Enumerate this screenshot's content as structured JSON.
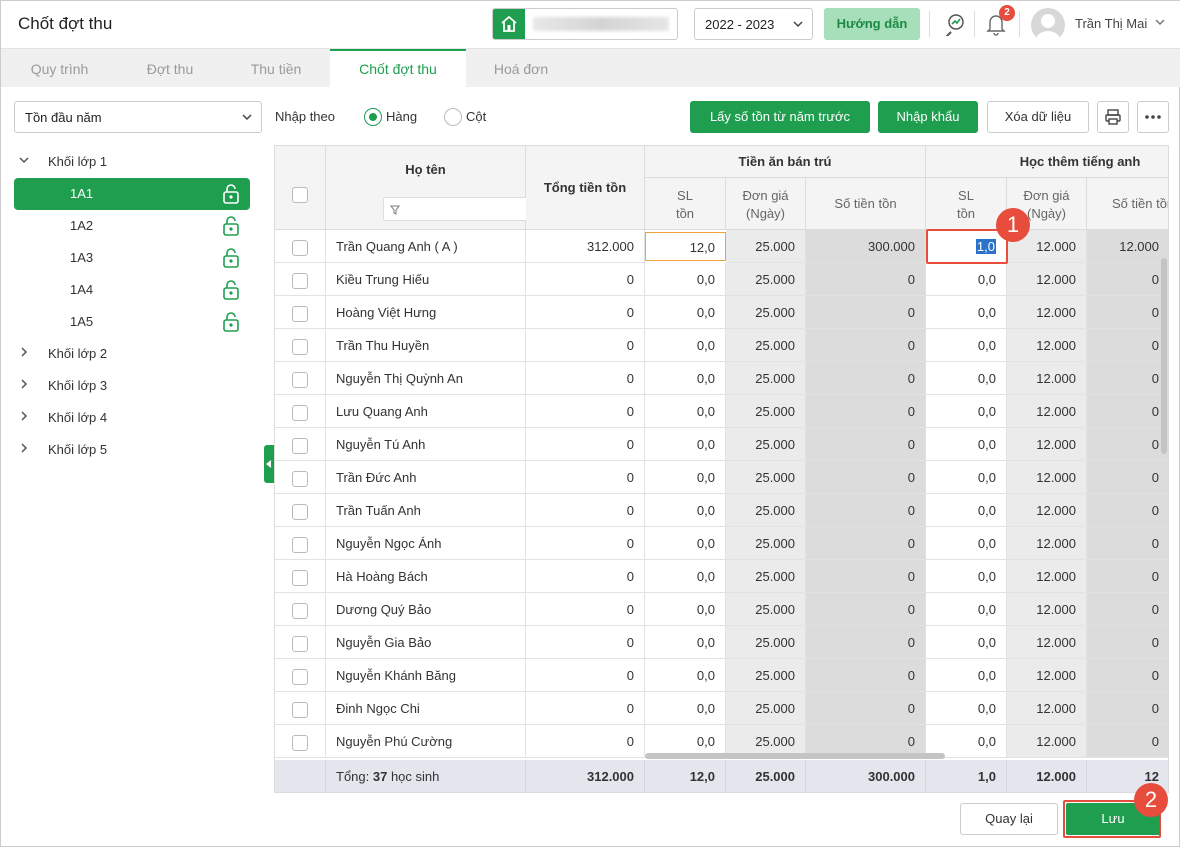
{
  "app": {
    "title": "Chốt đợt thu"
  },
  "header": {
    "school_year": "2022 - 2023",
    "guide_label": "Hướng dẫn",
    "notification_count": "2",
    "user_name": "Trần Thị Mai"
  },
  "tabs": [
    {
      "label": "Quy trình"
    },
    {
      "label": "Đợt thu"
    },
    {
      "label": "Thu tiền"
    },
    {
      "label": "Chốt đợt thu"
    },
    {
      "label": "Hoá đơn"
    }
  ],
  "toolbar": {
    "filter_value": "Tồn đầu năm",
    "input_by_label": "Nhập theo",
    "radio_row": "Hàng",
    "radio_col": "Cột",
    "btn_prev_year": "Lấy số tồn từ năm trước",
    "btn_import": "Nhập khẩu",
    "btn_delete": "Xóa dữ liệu"
  },
  "tree": {
    "groups": [
      {
        "label": "Khối lớp 1"
      },
      {
        "label": "Khối lớp 2"
      },
      {
        "label": "Khối lớp 3"
      },
      {
        "label": "Khối lớp 4"
      },
      {
        "label": "Khối lớp 5"
      }
    ],
    "classes": [
      {
        "label": "1A1"
      },
      {
        "label": "1A2"
      },
      {
        "label": "1A3"
      },
      {
        "label": "1A4"
      },
      {
        "label": "1A5"
      }
    ]
  },
  "table": {
    "col_name": "Họ tên",
    "col_total": "Tổng tiền tồn",
    "group1": "Tiền ăn bán trú",
    "group2": "Học thêm tiếng anh",
    "sub_sl": "SL",
    "sub_sl2": "tồn",
    "sub_price": "Đơn giá",
    "sub_price2": "(Ngày)",
    "sub_amount": "Số tiền tồn",
    "rows": [
      {
        "name": "Trần Quang Anh ( A )",
        "total": "312.000",
        "sl1": "12,0",
        "p1": "25.000",
        "a1": "300.000",
        "sl2": "1,0",
        "p2": "12.000",
        "a2": "12.000"
      },
      {
        "name": "Kiều Trung Hiếu",
        "total": "0",
        "sl1": "0,0",
        "p1": "25.000",
        "a1": "0",
        "sl2": "0,0",
        "p2": "12.000",
        "a2": "0"
      },
      {
        "name": "Hoàng Việt Hưng",
        "total": "0",
        "sl1": "0,0",
        "p1": "25.000",
        "a1": "0",
        "sl2": "0,0",
        "p2": "12.000",
        "a2": "0"
      },
      {
        "name": "Trần Thu Huyền",
        "total": "0",
        "sl1": "0,0",
        "p1": "25.000",
        "a1": "0",
        "sl2": "0,0",
        "p2": "12.000",
        "a2": "0"
      },
      {
        "name": "Nguyễn Thị Quỳnh An",
        "total": "0",
        "sl1": "0,0",
        "p1": "25.000",
        "a1": "0",
        "sl2": "0,0",
        "p2": "12.000",
        "a2": "0"
      },
      {
        "name": "Lưu Quang Anh",
        "total": "0",
        "sl1": "0,0",
        "p1": "25.000",
        "a1": "0",
        "sl2": "0,0",
        "p2": "12.000",
        "a2": "0"
      },
      {
        "name": "Nguyễn Tú Anh",
        "total": "0",
        "sl1": "0,0",
        "p1": "25.000",
        "a1": "0",
        "sl2": "0,0",
        "p2": "12.000",
        "a2": "0"
      },
      {
        "name": "Trần Đức Anh",
        "total": "0",
        "sl1": "0,0",
        "p1": "25.000",
        "a1": "0",
        "sl2": "0,0",
        "p2": "12.000",
        "a2": "0"
      },
      {
        "name": "Trần Tuấn Anh",
        "total": "0",
        "sl1": "0,0",
        "p1": "25.000",
        "a1": "0",
        "sl2": "0,0",
        "p2": "12.000",
        "a2": "0"
      },
      {
        "name": "Nguyễn Ngọc Ánh",
        "total": "0",
        "sl1": "0,0",
        "p1": "25.000",
        "a1": "0",
        "sl2": "0,0",
        "p2": "12.000",
        "a2": "0"
      },
      {
        "name": "Hà Hoàng Bách",
        "total": "0",
        "sl1": "0,0",
        "p1": "25.000",
        "a1": "0",
        "sl2": "0,0",
        "p2": "12.000",
        "a2": "0"
      },
      {
        "name": "Dương Quý Bảo",
        "total": "0",
        "sl1": "0,0",
        "p1": "25.000",
        "a1": "0",
        "sl2": "0,0",
        "p2": "12.000",
        "a2": "0"
      },
      {
        "name": "Nguyễn Gia Bảo",
        "total": "0",
        "sl1": "0,0",
        "p1": "25.000",
        "a1": "0",
        "sl2": "0,0",
        "p2": "12.000",
        "a2": "0"
      },
      {
        "name": "Nguyễn Khánh Băng",
        "total": "0",
        "sl1": "0,0",
        "p1": "25.000",
        "a1": "0",
        "sl2": "0,0",
        "p2": "12.000",
        "a2": "0"
      },
      {
        "name": "Đinh Ngọc Chi",
        "total": "0",
        "sl1": "0,0",
        "p1": "25.000",
        "a1": "0",
        "sl2": "0,0",
        "p2": "12.000",
        "a2": "0"
      },
      {
        "name": "Nguyễn Phú Cường",
        "total": "0",
        "sl1": "0,0",
        "p1": "25.000",
        "a1": "0",
        "sl2": "0,0",
        "p2": "12.000",
        "a2": "0"
      }
    ],
    "footer": {
      "prefix": "Tổng: ",
      "count": "37",
      "suffix": " học sinh",
      "total": "312.000",
      "sl1": "12,0",
      "p1": "25.000",
      "a1": "300.000",
      "sl2": "1,0",
      "p2": "12.000",
      "a2": "12"
    }
  },
  "actions": {
    "back": "Quay lại",
    "save": "Lưu"
  },
  "steps": {
    "one": "1",
    "two": "2"
  }
}
